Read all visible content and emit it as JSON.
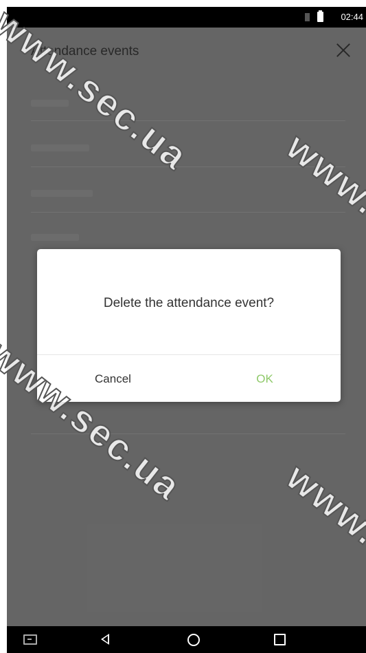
{
  "status_bar": {
    "time": "02:44"
  },
  "header": {
    "title": "Attendance events",
    "close_icon": "close-icon"
  },
  "dialog": {
    "message": "Delete the attendance event?",
    "cancel_label": "Cancel",
    "ok_label": "OK"
  },
  "nav_bar": {
    "icons": [
      "keyboard-icon",
      "back-icon",
      "home-icon",
      "recents-icon"
    ]
  },
  "watermarks": [
    "www.sec.ua",
    "www.sec.ua",
    "www.sec.ua",
    "www.sec.ua"
  ],
  "colors": {
    "ok": "#8fc96a",
    "scrim": "#6a6a6a"
  }
}
